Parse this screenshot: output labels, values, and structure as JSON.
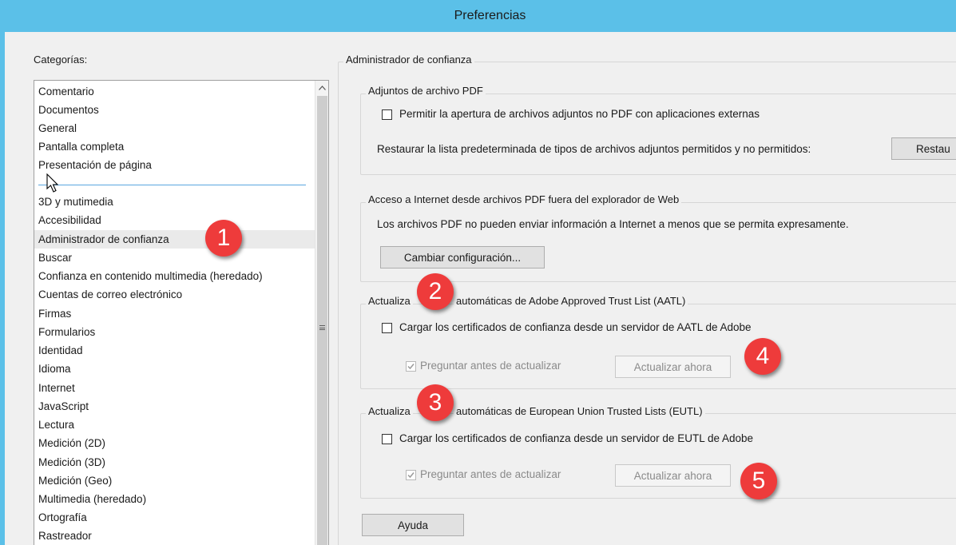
{
  "window": {
    "title": "Preferencias"
  },
  "categories": {
    "label": "Categorías:",
    "group1": [
      "Comentario",
      "Documentos",
      "General",
      "Pantalla completa",
      "Presentación de página"
    ],
    "group2": [
      "3D y mutimedia",
      "Accesibilidad",
      "Administrador de confianza",
      "Buscar",
      "Confianza en contenido multimedia (heredado)",
      "Cuentas de correo electrónico",
      "Firmas",
      "Formularios",
      "Identidad",
      "Idioma",
      "Internet",
      "JavaScript",
      "Lectura",
      "Medición (2D)",
      "Medición (3D)",
      "Medición (Geo)",
      "Multimedia (heredado)",
      "Ortografía",
      "Rastreador"
    ],
    "selected": "Administrador de confianza"
  },
  "panel": {
    "title": "Administrador de confianza",
    "attachments": {
      "legend": "Adjuntos de archivo PDF",
      "allow_label": "Permitir la apertura de archivos adjuntos no PDF con aplicaciones externas",
      "allow_checked": false,
      "restore_label": "Restaurar la lista predeterminada de tipos de archivos adjuntos permitidos y no permitidos:",
      "restore_button": "Restau"
    },
    "internet": {
      "legend": "Acceso a Internet desde archivos PDF fuera del explorador de Web",
      "text": "Los archivos PDF no pueden enviar información a Internet a menos que se permita expresamente.",
      "button": "Cambiar configuración..."
    },
    "aatl": {
      "legend_start": "Actualiza",
      "legend_end": "automáticas de Adobe Approved Trust List (AATL)",
      "load_label": "Cargar los certificados de confianza desde un servidor de AATL de Adobe",
      "load_checked": false,
      "ask_label": "Preguntar antes de actualizar",
      "ask_checked": true,
      "update_button": "Actualizar ahora"
    },
    "eutl": {
      "legend_start": "Actualiza",
      "legend_end": "automáticas de European Union Trusted Lists (EUTL)",
      "load_label": "Cargar los certificados de confianza desde un servidor de EUTL de Adobe",
      "load_checked": false,
      "ask_label": "Preguntar antes de actualizar",
      "ask_checked": true,
      "update_button": "Actualizar ahora"
    },
    "help_button": "Ayuda"
  },
  "annotations": [
    "1",
    "2",
    "3",
    "4",
    "5"
  ],
  "colors": {
    "titlebar": "#5bc0e8",
    "badge": "#ee3b3b",
    "separator": "#5aa7e0"
  }
}
